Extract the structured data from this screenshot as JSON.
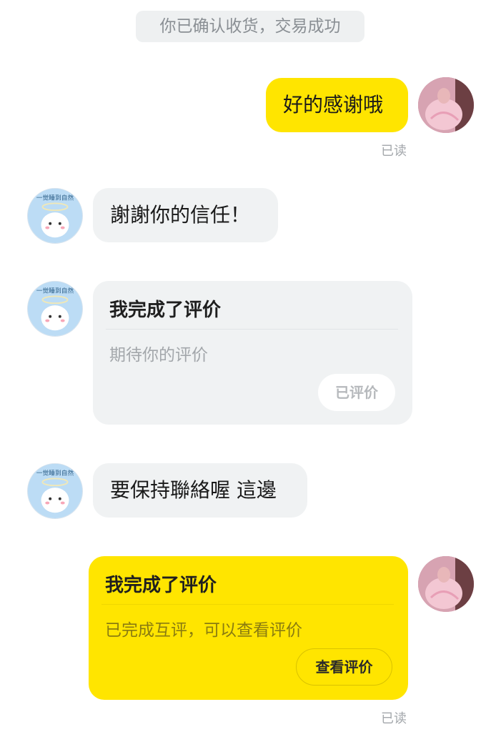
{
  "system_notice": "你已确认收货，交易成功",
  "messages": [
    {
      "text": "好的感谢哦",
      "status": "已读"
    },
    {
      "text": "謝謝你的信任！"
    },
    {
      "title": "我完成了评价",
      "subtitle": "期待你的评价",
      "button": "已评价"
    },
    {
      "text": "要保持聯絡喔 這邊"
    },
    {
      "title": "我完成了评价",
      "subtitle": "已完成互评，可以查看评价",
      "button": "查看评价",
      "status": "已读"
    }
  ],
  "other_avatar_text": "一觉睡到自然",
  "colors": {
    "accent_yellow": "#ffe500",
    "bubble_gray": "#f0f2f3",
    "muted_text": "#a3a7ab"
  }
}
